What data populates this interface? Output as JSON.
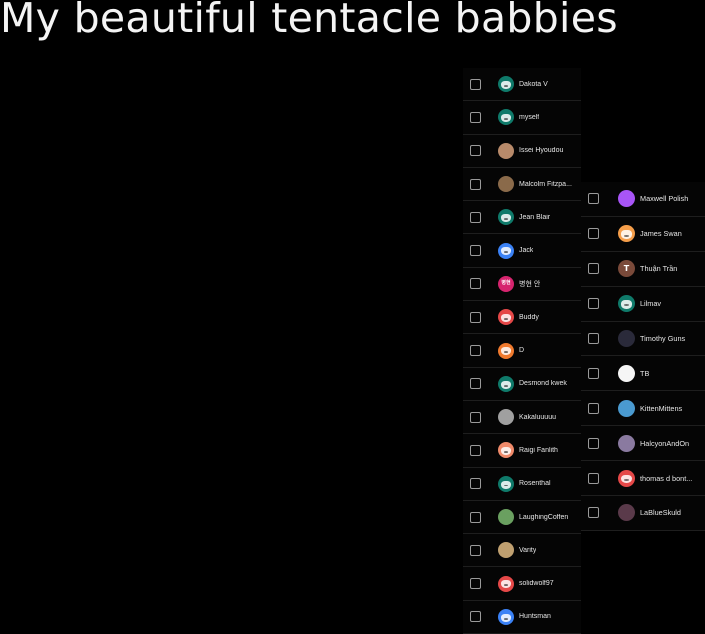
{
  "title": "My beautiful tentacle babbies",
  "left_list": [
    {
      "name": "Dakota V",
      "avatar_color": "#0f7a6a",
      "avatar_icon": "cat-face-icon",
      "glyph": ""
    },
    {
      "name": "myself",
      "avatar_color": "#0f7a6a",
      "avatar_icon": "cat-face-icon",
      "glyph": ""
    },
    {
      "name": "Issei Hyoudou",
      "avatar_color": "#b88a6a",
      "avatar_icon": "photo-avatar-icon",
      "glyph": ""
    },
    {
      "name": "Malcolm Fitzpa...",
      "avatar_color": "#8a6a4a",
      "avatar_icon": "photo-avatar-icon",
      "glyph": ""
    },
    {
      "name": "Jean Blair",
      "avatar_color": "#0f7a6a",
      "avatar_icon": "cat-face-icon",
      "glyph": ""
    },
    {
      "name": "Jack",
      "avatar_color": "#3b82f6",
      "avatar_icon": "cat-face-icon",
      "glyph": ""
    },
    {
      "name": "병현 안",
      "avatar_color": "#d6246e",
      "avatar_icon": "initials-avatar-icon",
      "glyph": "병현"
    },
    {
      "name": "Buddy",
      "avatar_color": "#e54848",
      "avatar_icon": "cat-face-icon",
      "glyph": ""
    },
    {
      "name": "D",
      "avatar_color": "#f07a2e",
      "avatar_icon": "cat-face-icon",
      "glyph": ""
    },
    {
      "name": "Desmond kwek",
      "avatar_color": "#0f7a6a",
      "avatar_icon": "cat-face-icon",
      "glyph": ""
    },
    {
      "name": "Kakaluuuuu",
      "avatar_color": "#a0a0a0",
      "avatar_icon": "photo-avatar-icon",
      "glyph": ""
    },
    {
      "name": "Raigi Fanlith",
      "avatar_color": "#f08a6a",
      "avatar_icon": "cat-face-icon",
      "glyph": ""
    },
    {
      "name": "Rosenthal",
      "avatar_color": "#0f7a6a",
      "avatar_icon": "cat-face-icon",
      "glyph": ""
    },
    {
      "name": "LaughingCoffen",
      "avatar_color": "#6aa060",
      "avatar_icon": "photo-avatar-icon",
      "glyph": ""
    },
    {
      "name": "Varity",
      "avatar_color": "#c0a070",
      "avatar_icon": "photo-avatar-icon",
      "glyph": ""
    },
    {
      "name": "solidwolf97",
      "avatar_color": "#e54848",
      "avatar_icon": "cat-face-icon",
      "glyph": ""
    },
    {
      "name": "Huntsman",
      "avatar_color": "#3b82f6",
      "avatar_icon": "cat-face-icon",
      "glyph": ""
    }
  ],
  "right_list": [
    {
      "name": "Maxwell Polish",
      "avatar_color": "#a855f7",
      "avatar_icon": "photo-avatar-icon",
      "glyph": ""
    },
    {
      "name": "James Swan",
      "avatar_color": "#f59e4a",
      "avatar_icon": "cat-face-icon",
      "glyph": ""
    },
    {
      "name": "Thuận Trần",
      "avatar_color": "#7a4a3a",
      "avatar_icon": "initials-avatar-icon",
      "glyph": "T"
    },
    {
      "name": "Lilmav",
      "avatar_color": "#0f7a6a",
      "avatar_icon": "cat-face-icon",
      "glyph": ""
    },
    {
      "name": "Timothy Guns",
      "avatar_color": "#2a2a3a",
      "avatar_icon": "photo-avatar-icon",
      "glyph": ""
    },
    {
      "name": "TB",
      "avatar_color": "#f5f5f5",
      "avatar_icon": "photo-avatar-icon",
      "glyph": ""
    },
    {
      "name": "KittenMittens",
      "avatar_color": "#4a9ad0",
      "avatar_icon": "photo-avatar-icon",
      "glyph": ""
    },
    {
      "name": "HalcyonAndOn",
      "avatar_color": "#8a7aa0",
      "avatar_icon": "photo-avatar-icon",
      "glyph": ""
    },
    {
      "name": "thomas d bont...",
      "avatar_color": "#e54848",
      "avatar_icon": "cat-face-icon",
      "glyph": ""
    },
    {
      "name": "LaBlueSkuld",
      "avatar_color": "#5a3a4a",
      "avatar_icon": "photo-avatar-icon",
      "glyph": ""
    }
  ]
}
